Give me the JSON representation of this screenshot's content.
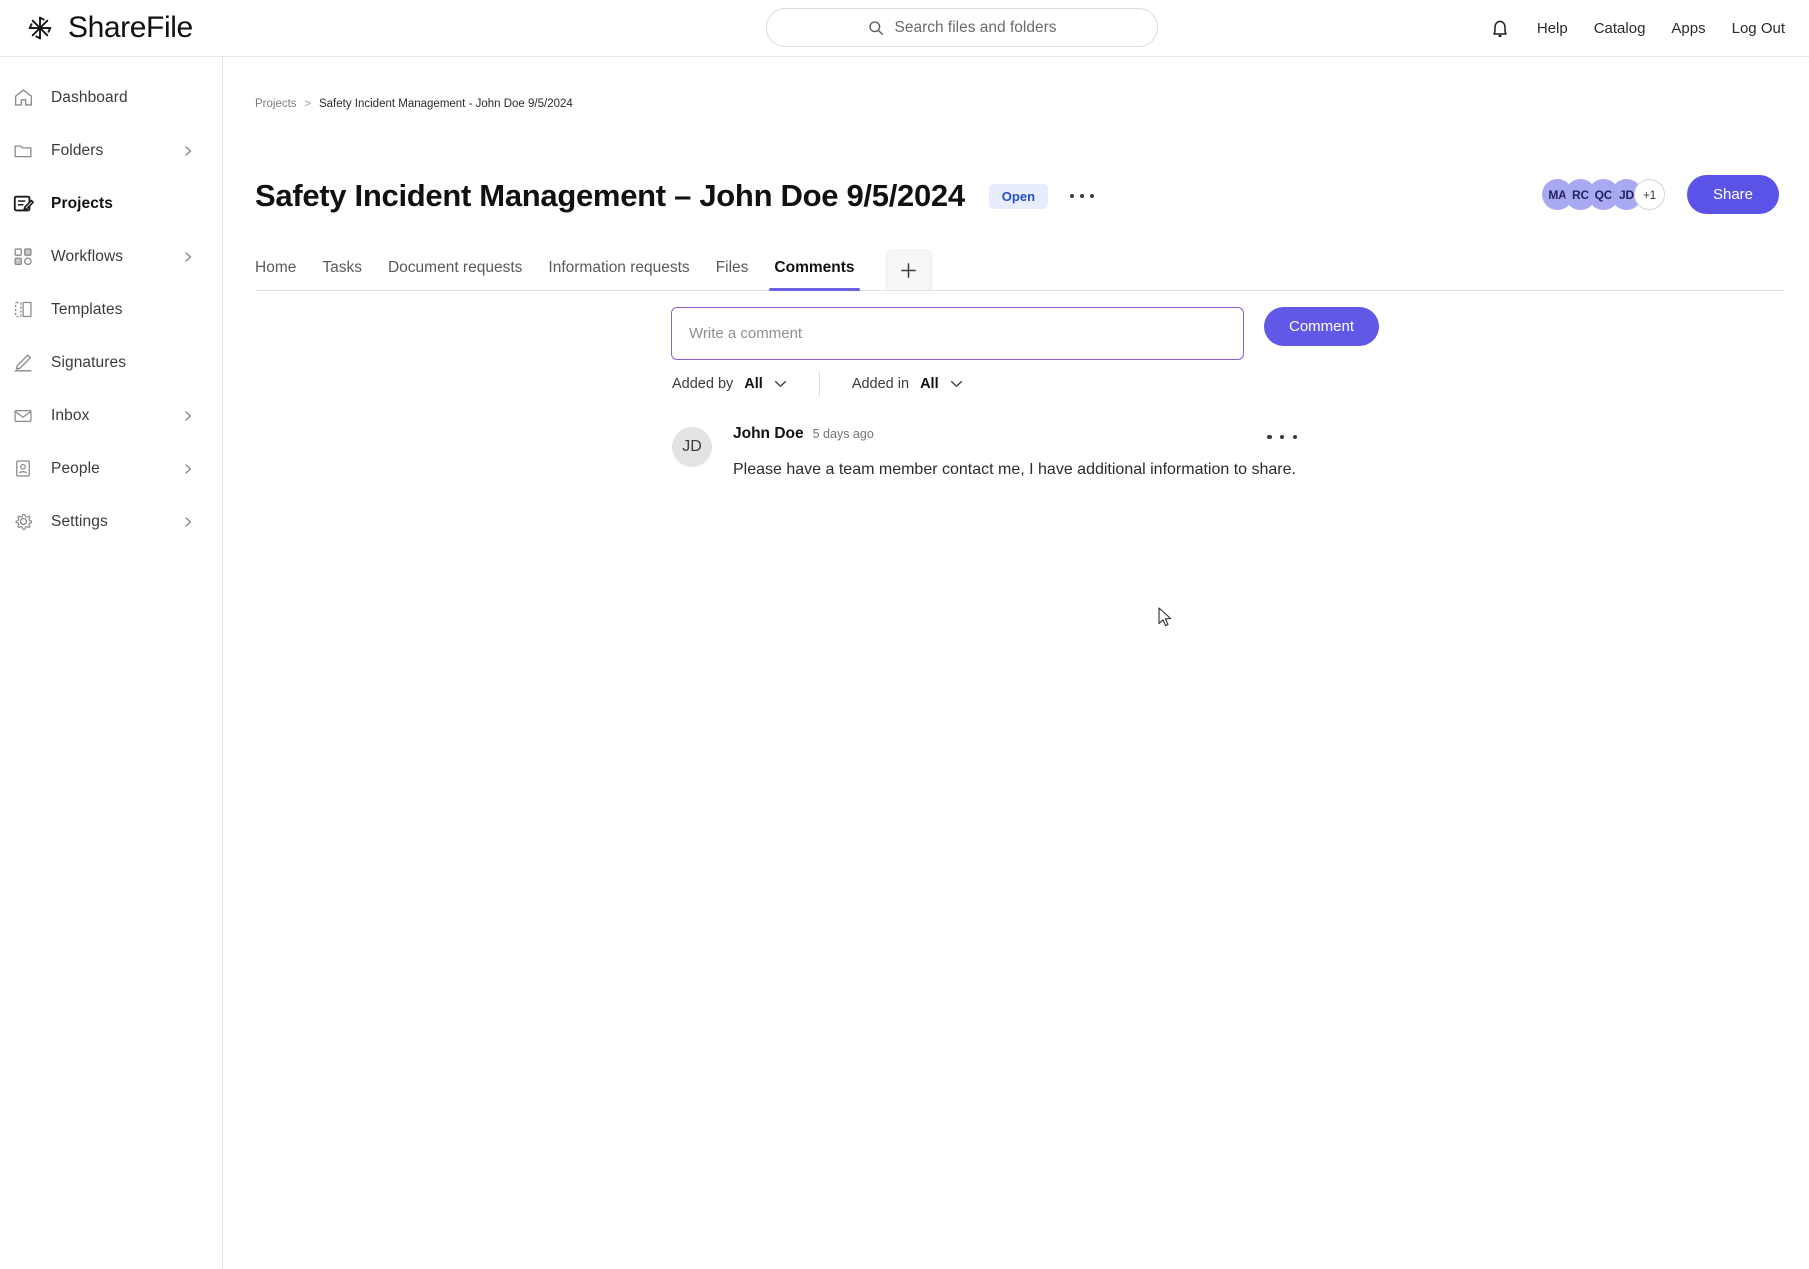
{
  "brand": {
    "name": "ShareFile",
    "logo_icon": "sharefile-pinwheel-icon"
  },
  "search": {
    "placeholder": "Search files and folders",
    "icon": "search-icon",
    "value": ""
  },
  "topbar": {
    "notifications_icon": "bell-icon",
    "links": [
      {
        "label": "Help"
      },
      {
        "label": "Catalog"
      },
      {
        "label": "Apps"
      },
      {
        "label": "Log Out"
      }
    ]
  },
  "sidebar": {
    "items": [
      {
        "label": "Dashboard",
        "icon": "home-icon",
        "chevron": false,
        "active": false
      },
      {
        "label": "Folders",
        "icon": "folder-icon",
        "chevron": true,
        "active": false
      },
      {
        "label": "Projects",
        "icon": "projects-icon",
        "chevron": false,
        "active": true
      },
      {
        "label": "Workflows",
        "icon": "workflows-icon",
        "chevron": true,
        "active": false
      },
      {
        "label": "Templates",
        "icon": "templates-icon",
        "chevron": false,
        "active": false
      },
      {
        "label": "Signatures",
        "icon": "signature-pen-icon",
        "chevron": false,
        "active": false
      },
      {
        "label": "Inbox",
        "icon": "envelope-icon",
        "chevron": true,
        "active": false
      },
      {
        "label": "People",
        "icon": "person-card-icon",
        "chevron": true,
        "active": false
      },
      {
        "label": "Settings",
        "icon": "gear-icon",
        "chevron": true,
        "active": false
      }
    ]
  },
  "breadcrumb": {
    "root": "Projects",
    "separator": ">",
    "current": "Safety Incident Management - John Doe 9/5/2024"
  },
  "page": {
    "title": "Safety Incident Management – John Doe 9/5/2024",
    "status": "Open",
    "status_bg": "#e7edfd",
    "status_color": "#2250c5",
    "overflow_icon": "kebab-menu-icon"
  },
  "members": {
    "avatars": [
      {
        "initials": "MA"
      },
      {
        "initials": "RC"
      },
      {
        "initials": "QC"
      },
      {
        "initials": "JD"
      }
    ],
    "overflow": "+1",
    "avatar_color": "#a9a9f2",
    "share_label": "Share",
    "share_color": "#5b52e8"
  },
  "tabs": {
    "items": [
      {
        "label": "Home",
        "active": false
      },
      {
        "label": "Tasks",
        "active": false
      },
      {
        "label": "Document requests",
        "active": false
      },
      {
        "label": "Information requests",
        "active": false
      },
      {
        "label": "Files",
        "active": false
      },
      {
        "label": "Comments",
        "active": true
      }
    ],
    "add_icon": "plus-icon",
    "active_underline_color": "#6b5fe3"
  },
  "composer": {
    "placeholder": "Write a comment",
    "value": "",
    "submit_label": "Comment",
    "focus_border": "#8b5fd6",
    "submit_color": "#6258e8"
  },
  "filters": [
    {
      "label": "Added by",
      "value": "All",
      "chevron_icon": "chevron-down-icon"
    },
    {
      "label": "Added in",
      "value": "All",
      "chevron_icon": "chevron-down-icon"
    }
  ],
  "comments": [
    {
      "avatar_initials": "JD",
      "author": "John Doe",
      "time": "5 days ago",
      "text": "Please have a team member contact me, I have additional information to share.",
      "overflow_icon": "kebab-menu-icon"
    }
  ],
  "cursor": {
    "icon": "mouse-pointer-icon"
  }
}
